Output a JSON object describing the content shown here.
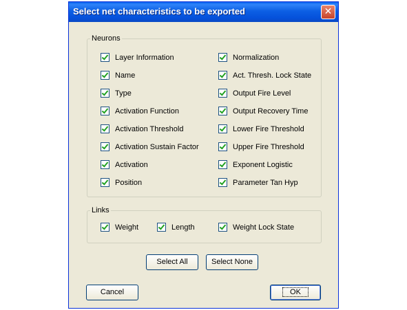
{
  "window": {
    "title": "Select net characteristics to be exported",
    "close_glyph": "✕"
  },
  "neurons": {
    "label": "Neurons",
    "left": [
      {
        "label": "Layer Information",
        "checked": true
      },
      {
        "label": "Name",
        "checked": true
      },
      {
        "label": "Type",
        "checked": true
      },
      {
        "label": "Activation Function",
        "checked": true
      },
      {
        "label": "Activation Threshold",
        "checked": true
      },
      {
        "label": "Activation Sustain Factor",
        "checked": true
      },
      {
        "label": "Activation",
        "checked": true
      },
      {
        "label": "Position",
        "checked": true
      }
    ],
    "right": [
      {
        "label": "Normalization",
        "checked": true
      },
      {
        "label": "Act. Thresh. Lock State",
        "checked": true
      },
      {
        "label": "Output Fire Level",
        "checked": true
      },
      {
        "label": "Output Recovery Time",
        "checked": true
      },
      {
        "label": "Lower Fire Threshold",
        "checked": true
      },
      {
        "label": "Upper Fire Threshold",
        "checked": true
      },
      {
        "label": "Exponent Logistic",
        "checked": true
      },
      {
        "label": "Parameter Tan Hyp",
        "checked": true
      }
    ]
  },
  "links": {
    "label": "Links",
    "items": [
      {
        "label": "Weight",
        "checked": true
      },
      {
        "label": "Length",
        "checked": true
      },
      {
        "label": "Weight Lock State",
        "checked": true
      }
    ]
  },
  "buttons": {
    "select_all": "Select All",
    "select_none": "Select None",
    "cancel": "Cancel",
    "ok": "OK"
  }
}
